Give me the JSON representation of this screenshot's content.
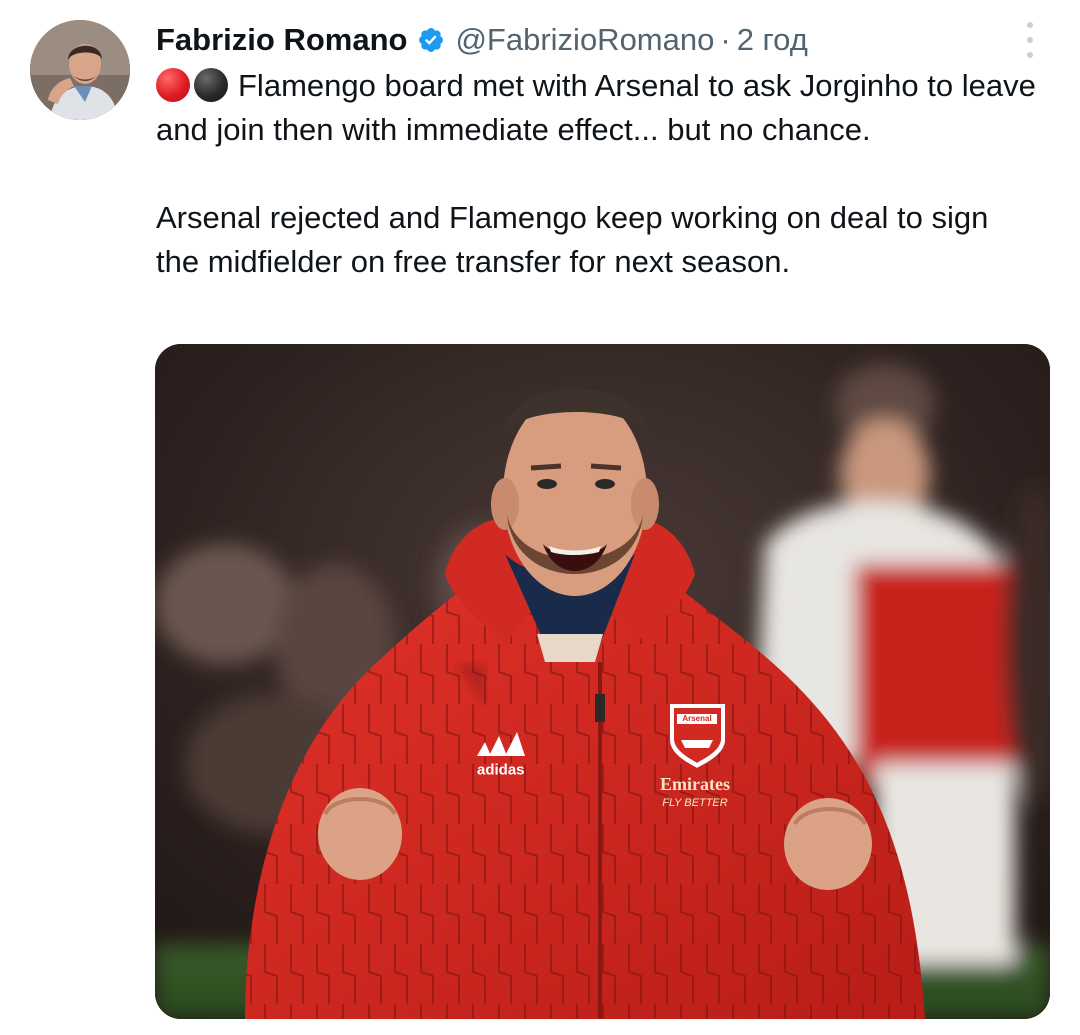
{
  "author": {
    "name": "Fabrizio Romano",
    "handle": "@FabrizioRomano",
    "separator": "·",
    "time": "2 год"
  },
  "icons": {
    "avatar": "profile-photo",
    "verified": "verified-badge-icon",
    "more": "more-options-icon",
    "emoji_1": "red-circle-emoji",
    "emoji_2": "black-circle-emoji"
  },
  "colors": {
    "verified": "#1d9bf0",
    "text": "#0f1419",
    "secondary": "#536471",
    "jacket": "#d9281f"
  },
  "tweet": {
    "paragraph_1": "Flamengo board met with Arsenal to ask Jorginho to leave and join then with immediate effect... but no chance.",
    "paragraph_2": "Arsenal rejected and Flamengo keep working on deal to sign the midfielder on free transfer for next season."
  },
  "media": {
    "jacket_brand": "adidas",
    "crest_text": "Arsenal",
    "sponsor": "Emirates",
    "sponsor_tagline": "FLY BETTER"
  }
}
